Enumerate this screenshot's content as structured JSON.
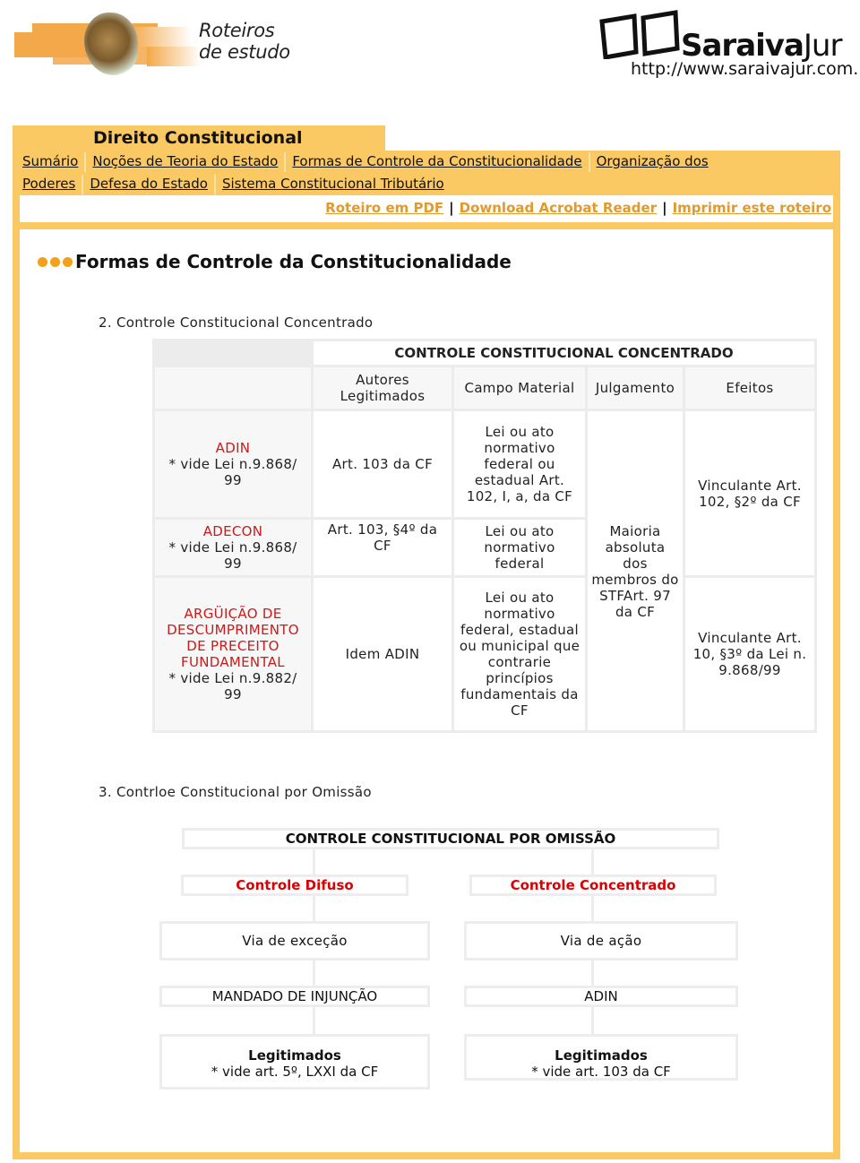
{
  "header": {
    "left_logo": {
      "line1": "Roteiros",
      "line2": "de estudo"
    },
    "right_logo": {
      "brand_bold": "Saraiva",
      "brand_light": "Jur",
      "url": "http://www.saraivajur.com.br"
    }
  },
  "course": {
    "title": "Direito Constitucional"
  },
  "nav": {
    "row1": [
      "Sumário",
      "Noções de Teoria do Estado",
      "Formas de Controle da Constitucionalidade",
      "Organização dos"
    ],
    "row2": [
      "Poderes",
      "Defesa do Estado",
      "Sistema Constitucional Tributário"
    ]
  },
  "links": {
    "pdf": "Roteiro em PDF",
    "acrobat": "Download Acrobat Reader",
    "print": "Imprimir este roteiro",
    "separator": "|"
  },
  "section": {
    "title": "Formas de Controle da Constitucionalidade",
    "bullet_icon": "three-orange-dots"
  },
  "concentrado": {
    "heading": "2. Controle Constitucional Concentrado",
    "table_title": "CONTROLE CONSTITUCIONAL CONCENTRADO",
    "columns": [
      "",
      "Autores Legitimados",
      "Campo Material",
      "Julgamento",
      "Efeitos"
    ],
    "rows": [
      {
        "name": "ADIN",
        "note": "* vide Lei n.9.868/ 99",
        "autores": "Art. 103 da CF",
        "campo": "Lei ou ato normativo federal ou estadual Art. 102, I, a, da CF"
      },
      {
        "name": "ADECON",
        "note": "* vide Lei n.9.868/ 99",
        "autores": "Art. 103, §4º da CF",
        "campo": "Lei ou ato normativo federal"
      },
      {
        "name": "ARGÜIÇÃO DE DESCUMPRIMENTO DE PRECEITO FUNDAMENTAL",
        "note": "* vide Lei n.9.882/ 99",
        "autores": "Idem ADIN",
        "campo": "Lei ou ato normativo federal, estadual ou municipal que contrarie princípios fundamentais da CF"
      }
    ],
    "julgamento": "Maioria absoluta dos membros do STFArt. 97 da CF",
    "efeitos": [
      "Vinculante Art. 102, §2º da CF",
      "Vinculante Art. 10, §3º da Lei n. 9.868/99"
    ]
  },
  "omissao": {
    "heading": "3. Contrloe Constitucional por Omissão",
    "root": "CONTROLE CONSTITUCIONAL POR OMISSÃO",
    "difuso": {
      "title": "Controle Difuso",
      "via": "Via de exceção",
      "instrumento": "MANDADO DE INJUNÇÃO",
      "legitimados_label": "Legitimados",
      "legitimados_note": "* vide art. 5º, LXXI da CF"
    },
    "concentrado": {
      "title": "Controle Concentrado",
      "via": "Via de ação",
      "instrumento": "ADIN",
      "legitimados_label": "Legitimados",
      "legitimados_note": "* vide art. 103 da CF"
    }
  },
  "colors": {
    "frame": "#fbc964",
    "link_orange": "#e09a2d",
    "accent_red": "#cc1a1a",
    "bullet_orange": "#f3a01b"
  }
}
